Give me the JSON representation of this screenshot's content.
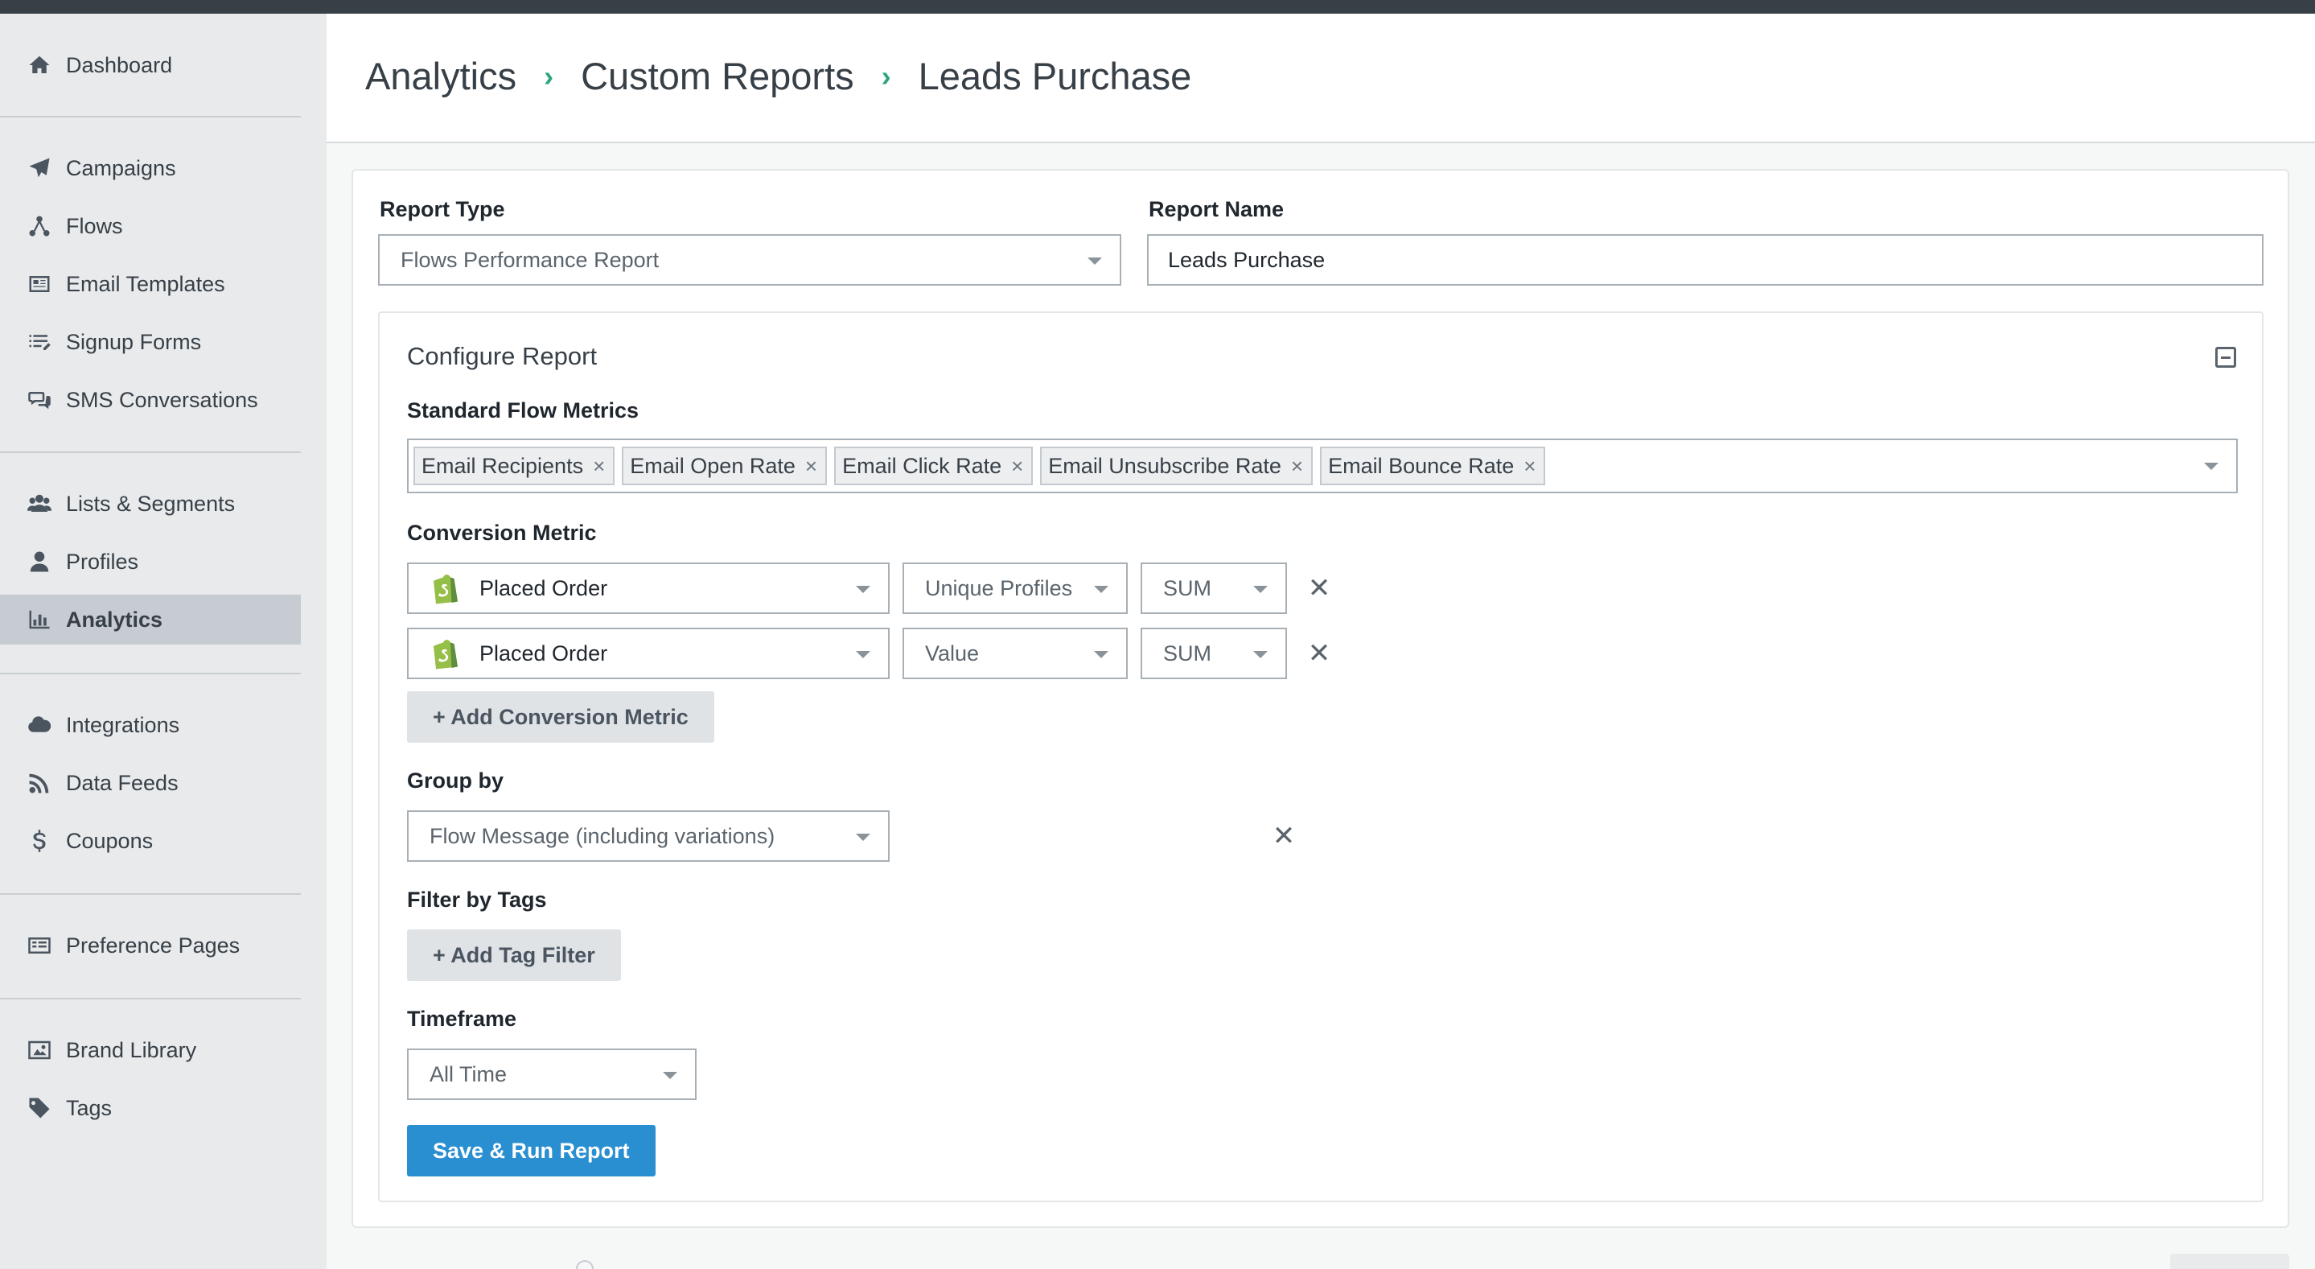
{
  "sidebar": {
    "items": [
      {
        "label": "Dashboard",
        "icon": "home-icon"
      },
      {
        "label": "Campaigns",
        "icon": "paper-plane-icon"
      },
      {
        "label": "Flows",
        "icon": "flows-icon"
      },
      {
        "label": "Email Templates",
        "icon": "email-template-icon"
      },
      {
        "label": "Signup Forms",
        "icon": "signup-form-icon"
      },
      {
        "label": "SMS Conversations",
        "icon": "chat-icon"
      },
      {
        "label": "Lists & Segments",
        "icon": "users-icon"
      },
      {
        "label": "Profiles",
        "icon": "user-icon"
      },
      {
        "label": "Analytics",
        "icon": "bar-chart-icon",
        "active": true
      },
      {
        "label": "Integrations",
        "icon": "cloud-icon"
      },
      {
        "label": "Data Feeds",
        "icon": "rss-icon"
      },
      {
        "label": "Coupons",
        "icon": "dollar-icon"
      },
      {
        "label": "Preference Pages",
        "icon": "preference-page-icon"
      },
      {
        "label": "Brand Library",
        "icon": "image-icon"
      },
      {
        "label": "Tags",
        "icon": "tag-icon"
      }
    ]
  },
  "breadcrumb": {
    "items": [
      "Analytics",
      "Custom Reports",
      "Leads Purchase"
    ],
    "separator": "›"
  },
  "form": {
    "report_type_label": "Report Type",
    "report_type_value": "Flows Performance Report",
    "report_name_label": "Report Name",
    "report_name_value": "Leads Purchase"
  },
  "configure": {
    "title": "Configure Report",
    "standard_metrics_label": "Standard Flow Metrics",
    "standard_metrics": [
      "Email Recipients",
      "Email Open Rate",
      "Email Click Rate",
      "Email Unsubscribe Rate",
      "Email Bounce Rate"
    ],
    "tag_remove_glyph": "×",
    "conversion_label": "Conversion Metric",
    "conversion_rows": [
      {
        "metric": "Placed Order",
        "measure": "Unique Profiles",
        "aggregate": "SUM"
      },
      {
        "metric": "Placed Order",
        "measure": "Value",
        "aggregate": "SUM"
      }
    ],
    "remove_glyph": "✕",
    "add_conversion_label": "+ Add Conversion Metric",
    "group_by_label": "Group by",
    "group_by_value": "Flow Message (including variations)",
    "filter_tags_label": "Filter by Tags",
    "add_tag_filter_label": "+ Add Tag Filter",
    "timeframe_label": "Timeframe",
    "timeframe_value": "All Time",
    "save_run_label": "Save & Run Report"
  },
  "colors": {
    "primary_button": "#2a8fd1",
    "breadcrumb_separator": "#2ca57e",
    "shopify_green": "#95bf47",
    "sidebar_bg": "#e8eaeb",
    "active_item": "#c6ccd1"
  }
}
